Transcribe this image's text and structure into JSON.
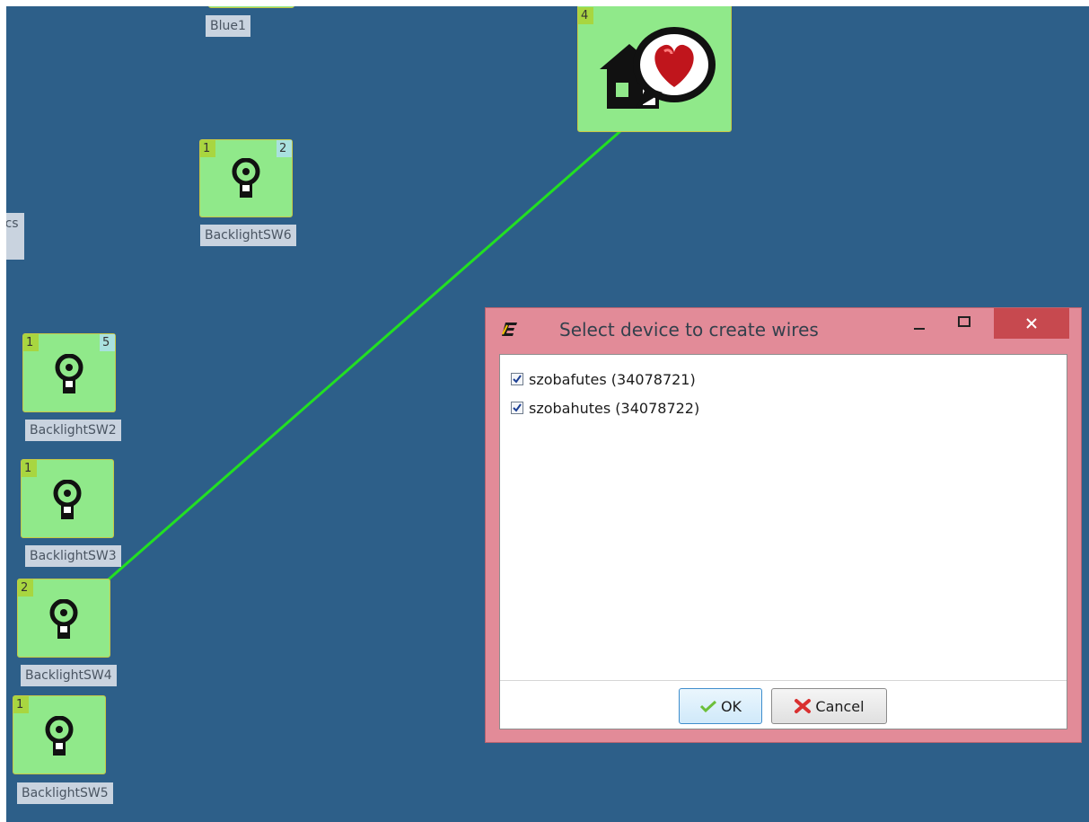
{
  "canvas": {
    "nodes": [
      {
        "label": "Blue1",
        "badge_left": "",
        "badge_right": ""
      },
      {
        "label": "",
        "badge_left": "4",
        "badge_right": ""
      },
      {
        "label": "BacklightSW6",
        "badge_left": "1",
        "badge_right": "2"
      },
      {
        "label": "ocs",
        "badge_left": "",
        "badge_right": ""
      },
      {
        "label": "BacklightSW2",
        "badge_left": "1",
        "badge_right": "5"
      },
      {
        "label": "BacklightSW3",
        "badge_left": "1",
        "badge_right": ""
      },
      {
        "label": "BacklightSW4",
        "badge_left": "2",
        "badge_right": ""
      },
      {
        "label": "BacklightSW5",
        "badge_left": "1",
        "badge_right": ""
      }
    ],
    "wire_color": "#22e022"
  },
  "dialog": {
    "title": "Select device to create wires",
    "items": [
      {
        "label": "szobafutes (34078721)",
        "checked": true
      },
      {
        "label": "szobahutes (34078722)",
        "checked": true
      }
    ],
    "ok_label": "OK",
    "cancel_label": "Cancel",
    "title_bar_color": "#e28b98",
    "close_color": "#c7494f"
  }
}
